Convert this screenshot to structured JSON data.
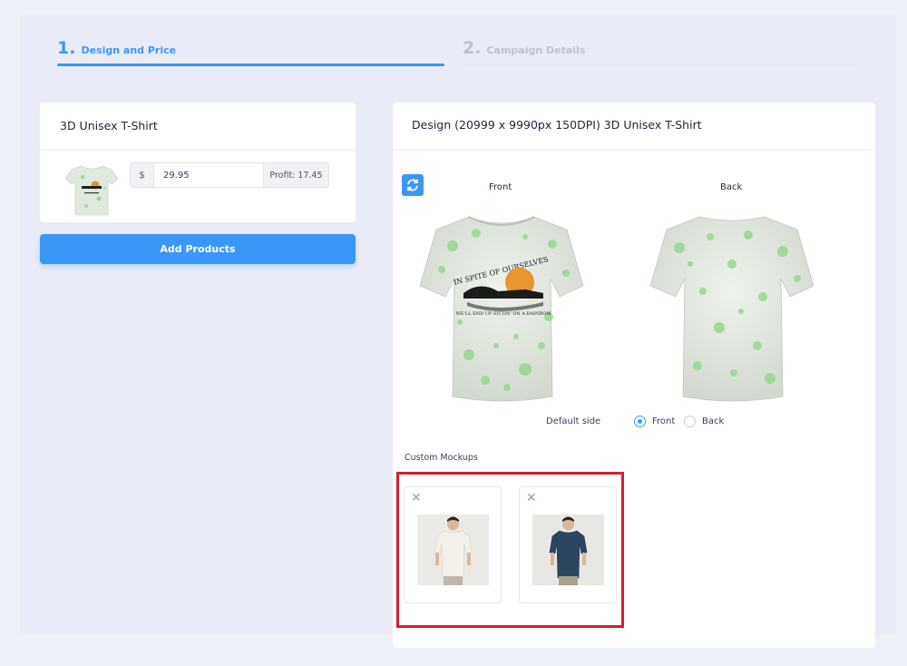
{
  "stepper": {
    "step1": {
      "num": "1.",
      "label": "Design and Price"
    },
    "step2": {
      "num": "2.",
      "label": "Campaign Details"
    }
  },
  "product": {
    "title": "3D Unisex T-Shirt",
    "currency": "$",
    "price": "29.95",
    "profit": "Profit: 17.45"
  },
  "add_products_label": "Add Products",
  "design": {
    "title": "Design (20999 x 9990px 150DPI) 3D Unisex T-Shirt",
    "front_label": "Front",
    "back_label": "Back",
    "shirt_front_text_top": "IN SPITE OF OURSELVES",
    "shirt_front_text_bottom": "WE'LL END UP SITTIN' ON A RAINBOW",
    "default_side_label": "Default side",
    "default_side_options": [
      "Front",
      "Back"
    ],
    "default_side_selected": "Front",
    "custom_mockups_label": "Custom Mockups"
  },
  "colors": {
    "accent": "#3b97f6",
    "highlight": "#d81b34"
  }
}
